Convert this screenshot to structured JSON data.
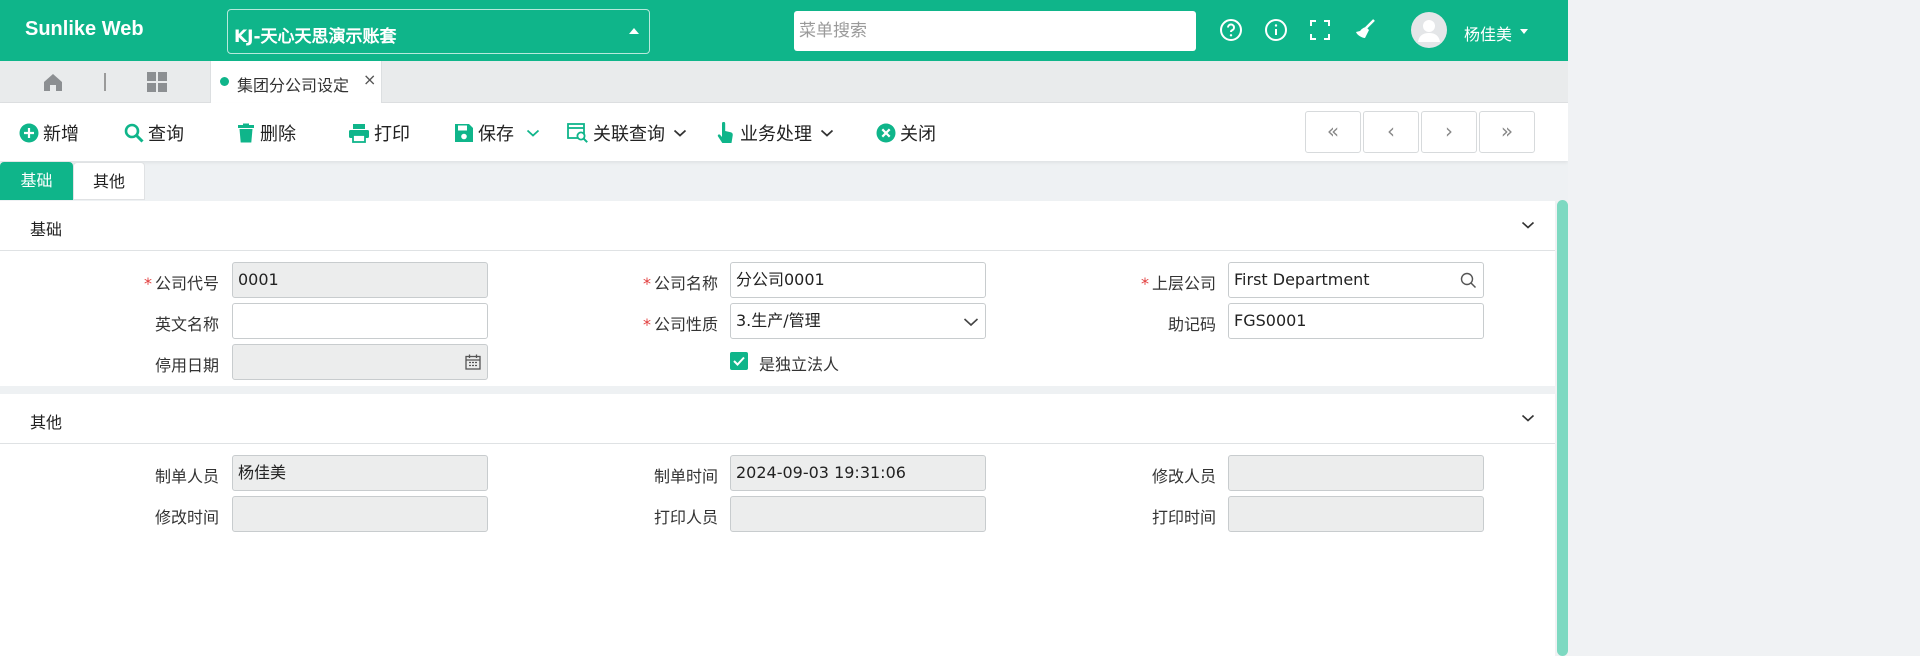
{
  "header": {
    "brand": "Sunlike Web",
    "account": "KJ-天心天思演示账套",
    "search_placeholder": "菜单搜索",
    "username": "杨佳美"
  },
  "tabs": {
    "open_tab": "集团分公司设定",
    "close": "×"
  },
  "toolbar": {
    "new": "新增",
    "query": "查询",
    "delete": "删除",
    "print": "打印",
    "save": "保存",
    "related_query": "关联查询",
    "business": "业务处理",
    "close": "关闭"
  },
  "nav": {
    "first": "«",
    "prev": "‹",
    "next": "›",
    "last": "»"
  },
  "section_tabs": {
    "basic": "基础",
    "other": "其他"
  },
  "basic_panel": {
    "title": "基础",
    "company_code_label": "公司代号",
    "company_code": "0001",
    "company_name_label": "公司名称",
    "company_name": "分公司0001",
    "parent_company_label": "上层公司",
    "parent_company": "First Department",
    "english_name_label": "英文名称",
    "english_name": "",
    "company_type_label": "公司性质",
    "company_type": "3.生产/管理",
    "mnemonic_label": "助记码",
    "mnemonic": "FGS0001",
    "disable_date_label": "停用日期",
    "disable_date": "",
    "independent_label": "是独立法人",
    "independent_checked": true,
    "required_mark": "*"
  },
  "other_panel": {
    "title": "其他",
    "creator_label": "制单人员",
    "creator": "杨佳美",
    "create_time_label": "制单时间",
    "create_time": "2024-09-03 19:31:06",
    "modifier_label": "修改人员",
    "modifier": "",
    "modify_time_label": "修改时间",
    "modify_time": "",
    "printer_label": "打印人员",
    "printer": "",
    "print_time_label": "打印时间",
    "print_time": ""
  },
  "colors": {
    "accent": "#0fb58a",
    "required": "#e23b3b"
  }
}
